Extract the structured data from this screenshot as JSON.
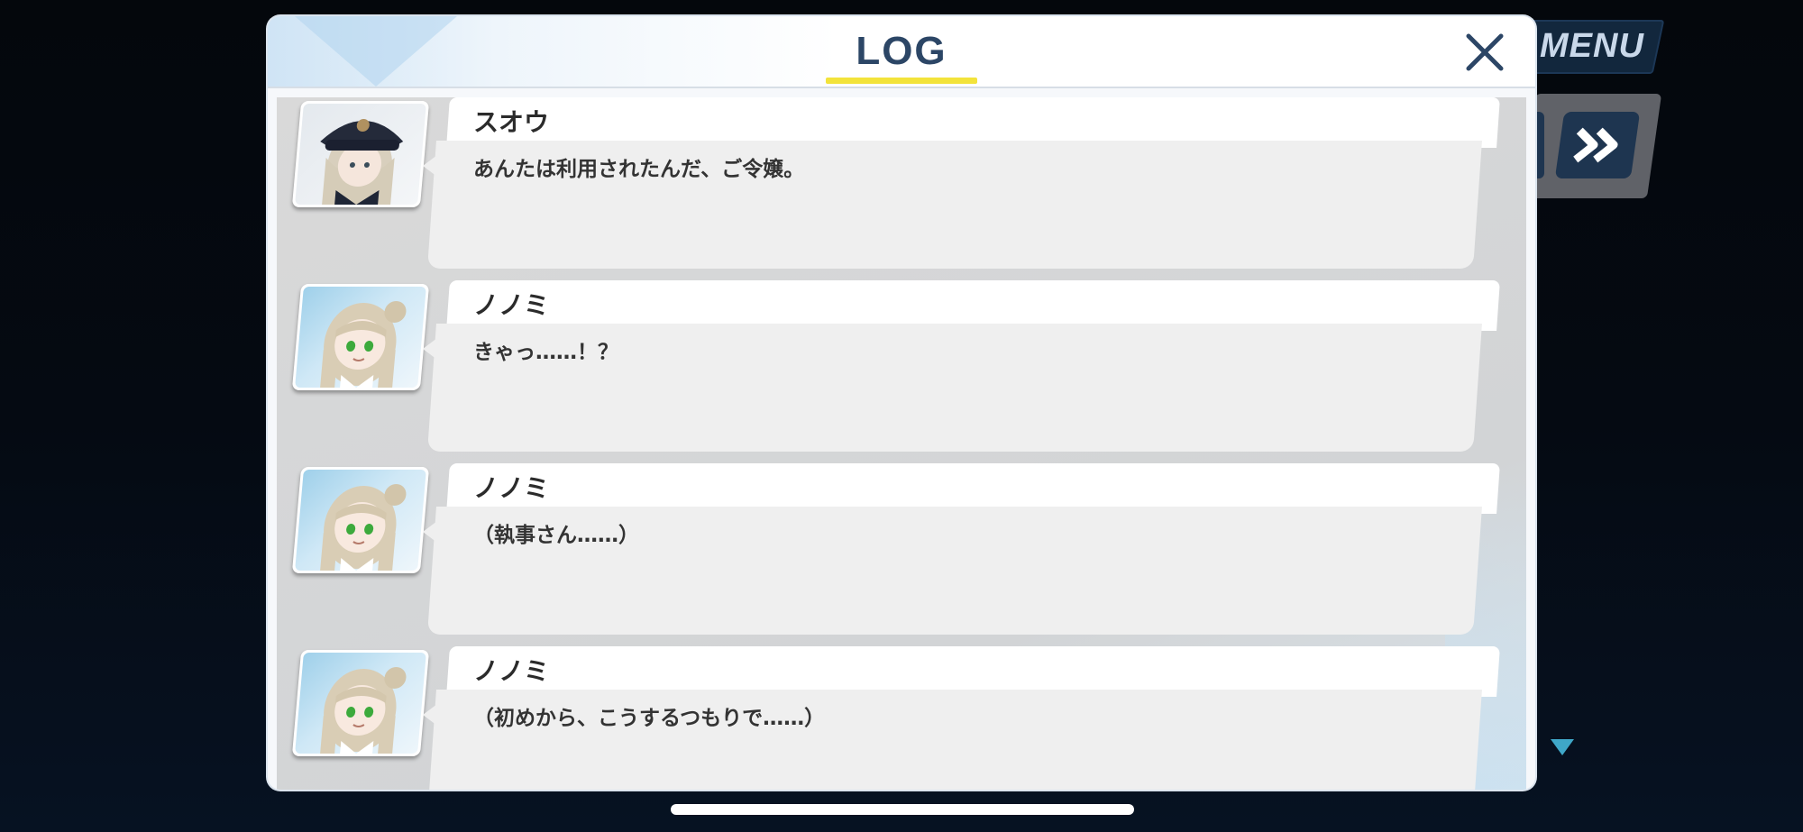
{
  "hud": {
    "menu_label": "MENU",
    "skip_icon": "double-chevron-right-icon",
    "scroll_icon": "triangle-down-icon"
  },
  "log": {
    "title": "LOG",
    "close_icon": "close-icon",
    "accent_color": "#f3e33b",
    "title_color": "#2c4666",
    "entries": [
      {
        "speaker": "スオウ",
        "message": "あんたは利用されたんだ、ご令嬢。",
        "portrait": "suou-portrait"
      },
      {
        "speaker": "ノノミ",
        "message": "きゃっ……！？",
        "portrait": "nonomi-portrait"
      },
      {
        "speaker": "ノノミ",
        "message": "（執事さん……）",
        "portrait": "nonomi-portrait"
      },
      {
        "speaker": "ノノミ",
        "message": "（初めから、こうするつもりで……）",
        "portrait": "nonomi-portrait"
      }
    ]
  }
}
